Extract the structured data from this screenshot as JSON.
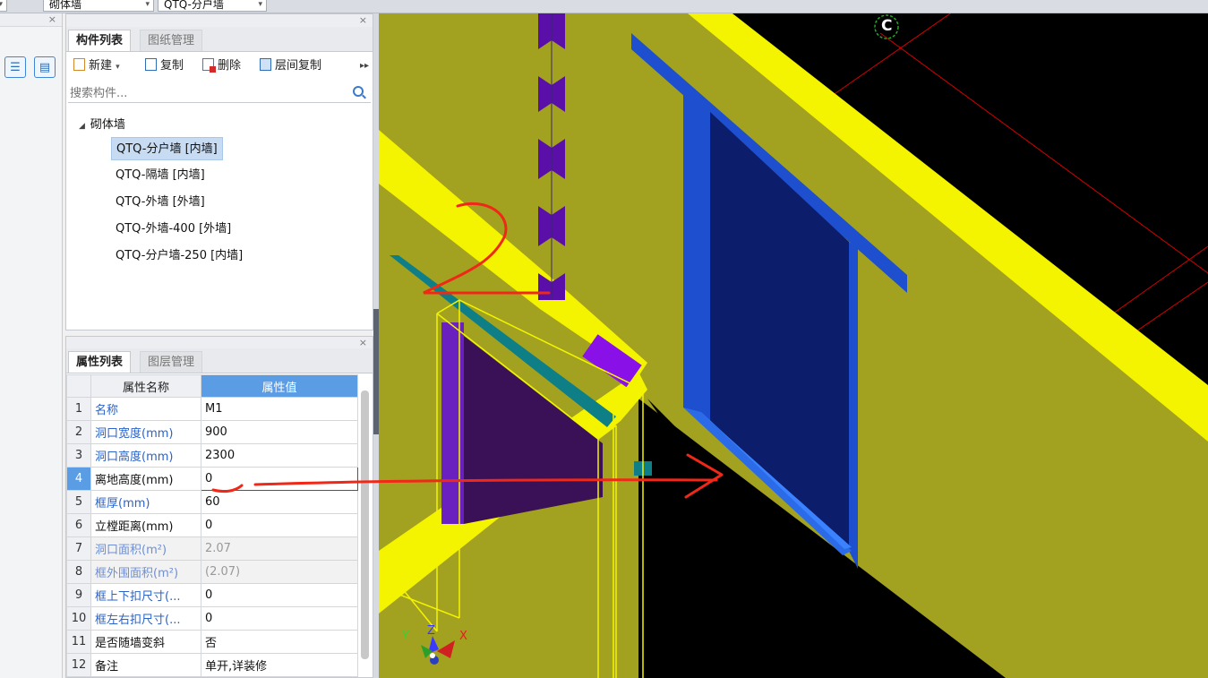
{
  "topbar": {
    "combo1": "砌体墙",
    "combo2": "QTQ-分户墙"
  },
  "component_panel": {
    "tabs": [
      {
        "label": "构件列表",
        "active": true
      },
      {
        "label": "图纸管理",
        "active": false
      }
    ],
    "toolbar": {
      "new": "新建",
      "copy": "复制",
      "delete": "删除",
      "floor_copy": "层间复制"
    },
    "search_placeholder": "搜索构件...",
    "tree_root": "砌体墙",
    "items": [
      "QTQ-分户墙 [内墙]",
      "QTQ-隔墙 [内墙]",
      "QTQ-外墙 [外墙]",
      "QTQ-外墙-400 [外墙]",
      "QTQ-分户墙-250 [内墙]"
    ],
    "selected_index": 0
  },
  "property_panel": {
    "tabs": [
      {
        "label": "属性列表",
        "active": true
      },
      {
        "label": "图层管理",
        "active": false
      }
    ],
    "col_name": "属性名称",
    "col_value": "属性值",
    "rows": [
      {
        "num": "1",
        "name": "名称",
        "value": "M1"
      },
      {
        "num": "2",
        "name": "洞口宽度(mm)",
        "value": "900"
      },
      {
        "num": "3",
        "name": "洞口高度(mm)",
        "value": "2300"
      },
      {
        "num": "4",
        "name": "离地高度(mm)",
        "value": "0"
      },
      {
        "num": "5",
        "name": "框厚(mm)",
        "value": "60"
      },
      {
        "num": "6",
        "name": "立樘距离(mm)",
        "value": "0"
      },
      {
        "num": "7",
        "name": "洞口面积(m²)",
        "value": "2.07"
      },
      {
        "num": "8",
        "name": "框外围面积(m²)",
        "value": "(2.07)"
      },
      {
        "num": "9",
        "name": "框上下扣尺寸(...",
        "value": "0"
      },
      {
        "num": "10",
        "name": "框左右扣尺寸(...",
        "value": "0"
      },
      {
        "num": "11",
        "name": "是否随墙变斜",
        "value": "否"
      },
      {
        "num": "12",
        "name": "备注",
        "value": "单开,详装修"
      }
    ]
  },
  "viewport": {
    "axis_label": "C",
    "axis_x": "X",
    "axis_y": "Y",
    "axis_z": "Z"
  }
}
